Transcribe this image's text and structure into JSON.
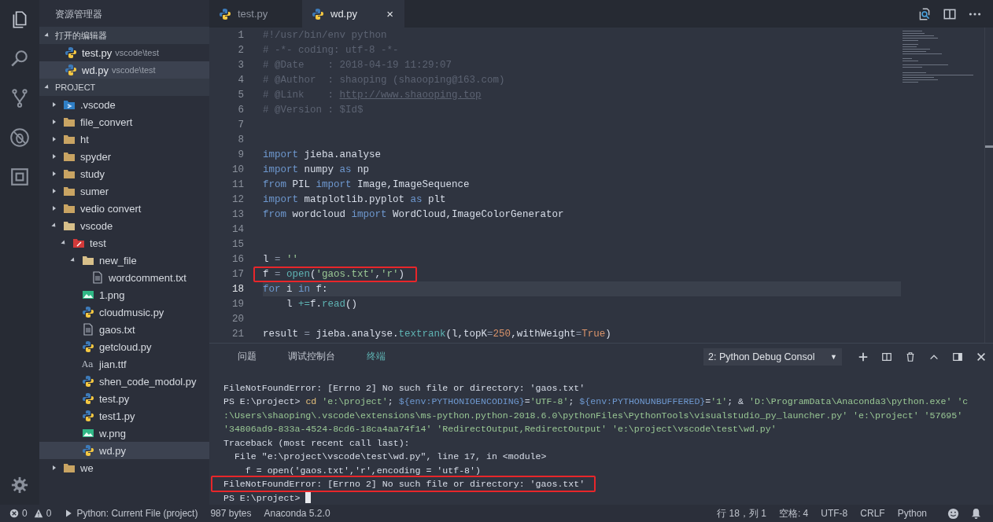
{
  "sidebar": {
    "title": "资源管理器",
    "open_editors": {
      "title": "打开的编辑器",
      "expanded": true,
      "items": [
        {
          "label": "test.py",
          "path": "vscode\\test",
          "kind": "python",
          "selected": false
        },
        {
          "label": "wd.py",
          "path": "vscode\\test",
          "kind": "python",
          "selected": true
        }
      ]
    },
    "project": {
      "title": "PROJECT",
      "expanded": true,
      "items": [
        {
          "label": ".vscode",
          "kind": "vscode-folder",
          "expanded": false,
          "selected": false
        },
        {
          "label": "file_convert",
          "kind": "folder",
          "expanded": false,
          "selected": false
        },
        {
          "label": "ht",
          "kind": "folder",
          "expanded": false,
          "selected": false
        },
        {
          "label": "spyder",
          "kind": "folder",
          "expanded": false,
          "selected": false
        },
        {
          "label": "study",
          "kind": "folder",
          "expanded": false,
          "selected": false
        },
        {
          "label": "sumer",
          "kind": "folder",
          "expanded": false,
          "selected": false
        },
        {
          "label": "vedio convert",
          "kind": "folder",
          "expanded": false,
          "selected": false
        },
        {
          "label": "vscode",
          "kind": "folder",
          "expanded": true,
          "selected": false,
          "children": [
            {
              "label": "test",
              "kind": "test-folder",
              "expanded": true,
              "selected": false,
              "children": [
                {
                  "label": "new_file",
                  "kind": "folder",
                  "expanded": true,
                  "selected": false,
                  "children": [
                    {
                      "label": "wordcomment.txt",
                      "kind": "text",
                      "selected": false
                    }
                  ]
                },
                {
                  "label": "1.png",
                  "kind": "image",
                  "selected": false
                },
                {
                  "label": "cloudmusic.py",
                  "kind": "python",
                  "selected": false
                },
                {
                  "label": "gaos.txt",
                  "kind": "text",
                  "selected": false
                },
                {
                  "label": "getcloud.py",
                  "kind": "python",
                  "selected": false
                },
                {
                  "label": "jian.ttf",
                  "kind": "font",
                  "glyph": "Aa",
                  "selected": false
                },
                {
                  "label": "shen_code_modol.py",
                  "kind": "python",
                  "selected": false
                },
                {
                  "label": "test.py",
                  "kind": "python",
                  "selected": false
                },
                {
                  "label": "test1.py",
                  "kind": "python",
                  "selected": false
                },
                {
                  "label": "w.png",
                  "kind": "image",
                  "selected": false
                },
                {
                  "label": "wd.py",
                  "kind": "python",
                  "selected": true
                }
              ]
            }
          ]
        },
        {
          "label": "we",
          "kind": "folder",
          "expanded": false,
          "selected": false
        }
      ]
    }
  },
  "tabs": [
    {
      "label": "test.py",
      "selected": false
    },
    {
      "label": "wd.py",
      "selected": true,
      "close": "×"
    }
  ],
  "editor": {
    "lines": [
      {
        "number": "1",
        "segments": [
          {
            "kind": "comment",
            "text": "#!/usr/bin/env python"
          }
        ]
      },
      {
        "number": "2",
        "segments": [
          {
            "kind": "comment",
            "text": "# -*- coding: utf-8 -*-"
          }
        ]
      },
      {
        "number": "3",
        "segments": [
          {
            "kind": "comment",
            "text": "# @Date    : 2018-04-19 11:29:07"
          }
        ]
      },
      {
        "number": "4",
        "segments": [
          {
            "kind": "comment",
            "text": "# @Author  : shaoping (shaooping@163.com)"
          }
        ]
      },
      {
        "number": "5",
        "segments": [
          {
            "kind": "comment",
            "text": "# @Link    : "
          },
          {
            "kind": "link",
            "text": "http://www.shaooping.top"
          }
        ]
      },
      {
        "number": "6",
        "segments": [
          {
            "kind": "comment",
            "text": "# @Version : $Id$"
          }
        ]
      },
      {
        "number": "7"
      },
      {
        "number": "8"
      },
      {
        "number": "9",
        "segments": [
          {
            "kind": "keyword",
            "text": "import"
          },
          {
            "kind": "plain",
            "text": " jieba.analyse"
          }
        ]
      },
      {
        "number": "10",
        "segments": [
          {
            "kind": "keyword",
            "text": "import"
          },
          {
            "kind": "plain",
            "text": " numpy "
          },
          {
            "kind": "keyword",
            "text": "as"
          },
          {
            "kind": "plain",
            "text": " np"
          }
        ]
      },
      {
        "number": "11",
        "segments": [
          {
            "kind": "keyword",
            "text": "from"
          },
          {
            "kind": "plain",
            "text": " PIL "
          },
          {
            "kind": "keyword",
            "text": "import"
          },
          {
            "kind": "plain",
            "text": " Image,ImageSequence"
          }
        ]
      },
      {
        "number": "12",
        "segments": [
          {
            "kind": "keyword",
            "text": "import"
          },
          {
            "kind": "plain",
            "text": " matplotlib.pyplot "
          },
          {
            "kind": "keyword",
            "text": "as"
          },
          {
            "kind": "plain",
            "text": " plt"
          }
        ]
      },
      {
        "number": "13",
        "segments": [
          {
            "kind": "keyword",
            "text": "from"
          },
          {
            "kind": "plain",
            "text": " wordcloud "
          },
          {
            "kind": "keyword",
            "text": "import"
          },
          {
            "kind": "plain",
            "text": " WordCloud,ImageColorGenerator"
          }
        ]
      },
      {
        "number": "14"
      },
      {
        "number": "15"
      },
      {
        "number": "16",
        "segments": [
          {
            "kind": "plain",
            "text": "l"
          },
          {
            "kind": "operator",
            "text": " = "
          },
          {
            "kind": "string",
            "text": "''"
          }
        ]
      },
      {
        "number": "17",
        "annotated": true,
        "segments": [
          {
            "kind": "plain",
            "text": "f"
          },
          {
            "kind": "operator",
            "text": " = "
          },
          {
            "kind": "function",
            "text": "open"
          },
          {
            "kind": "plain",
            "text": "("
          },
          {
            "kind": "string",
            "text": "'gaos.txt'"
          },
          {
            "kind": "plain",
            "text": ","
          },
          {
            "kind": "string",
            "text": "'r'"
          },
          {
            "kind": "plain",
            "text": ")"
          }
        ]
      },
      {
        "number": "18",
        "current": true,
        "segments": [
          {
            "kind": "keyword",
            "text": "for"
          },
          {
            "kind": "plain",
            "text": " i "
          },
          {
            "kind": "keyword",
            "text": "in"
          },
          {
            "kind": "plain",
            "text": " f:"
          }
        ]
      },
      {
        "number": "19",
        "segments": [
          {
            "kind": "plain",
            "text": "    l "
          },
          {
            "kind": "function",
            "text": "+="
          },
          {
            "kind": "plain",
            "text": "f."
          },
          {
            "kind": "function",
            "text": "read"
          },
          {
            "kind": "plain",
            "text": "()"
          }
        ]
      },
      {
        "number": "20"
      },
      {
        "number": "21",
        "segments": [
          {
            "kind": "plain",
            "text": "result"
          },
          {
            "kind": "operator",
            "text": " = "
          },
          {
            "kind": "plain",
            "text": "jieba.analyse."
          },
          {
            "kind": "function",
            "text": "textrank"
          },
          {
            "kind": "plain",
            "text": "(l,topK"
          },
          {
            "kind": "operator",
            "text": "="
          },
          {
            "kind": "number",
            "text": "250"
          },
          {
            "kind": "plain",
            "text": ",withWeight"
          },
          {
            "kind": "operator",
            "text": "="
          },
          {
            "kind": "number",
            "text": "True"
          },
          {
            "kind": "plain",
            "text": ")"
          }
        ]
      }
    ]
  },
  "panel": {
    "tabs": [
      {
        "label": "问题",
        "selected": false
      },
      {
        "label": "调试控制台",
        "selected": false
      },
      {
        "label": "终端",
        "selected": true
      }
    ],
    "terminal_select": {
      "value": "2: Python Debug Consol",
      "arrow": "▼"
    },
    "lines": [
      {
        "segments": [
          {
            "kind": "plain",
            "text": "FileNotFoundError: [Errno 2] No such file or directory: 'gaos.txt'"
          }
        ]
      },
      {
        "segments": [
          {
            "kind": "plain",
            "text": "PS E:\\project> "
          },
          {
            "kind": "command",
            "text": "cd"
          },
          {
            "kind": "string",
            "text": " 'e:\\project'"
          },
          {
            "kind": "plain",
            "text": "; "
          },
          {
            "kind": "variable",
            "text": "${env:PYTHONIOENCODING}"
          },
          {
            "kind": "plain",
            "text": "="
          },
          {
            "kind": "string",
            "text": "'UTF-8'"
          },
          {
            "kind": "plain",
            "text": "; "
          },
          {
            "kind": "variable",
            "text": "${env:PYTHONUNBUFFERED}"
          },
          {
            "kind": "plain",
            "text": "="
          },
          {
            "kind": "string",
            "text": "'1'"
          },
          {
            "kind": "plain",
            "text": "; & "
          },
          {
            "kind": "string",
            "text": "'D:\\ProgramData\\Anaconda3\\python.exe' 'c"
          }
        ]
      },
      {
        "segments": [
          {
            "kind": "string",
            "text": ":\\Users\\shaoping\\.vscode\\extensions\\ms-python.python-2018.6.0\\pythonFiles\\PythonTools\\visualstudio_py_launcher.py' 'e:\\project' '57695'"
          }
        ]
      },
      {
        "segments": [
          {
            "kind": "string",
            "text": "'34806ad9-833a-4524-8cd6-18ca4aa74f14' 'RedirectOutput,RedirectOutput' 'e:\\project\\vscode\\test\\wd.py'"
          }
        ]
      },
      {
        "segments": [
          {
            "kind": "plain",
            "text": "Traceback (most recent call last):"
          }
        ]
      },
      {
        "segments": [
          {
            "kind": "plain",
            "text": "  File \"e:\\project\\vscode\\test\\wd.py\", line 17, in <module>"
          }
        ]
      },
      {
        "segments": [
          {
            "kind": "plain",
            "text": "    f = open('gaos.txt','r',encoding = 'utf-8')"
          }
        ]
      },
      {
        "annotated": true,
        "segments": [
          {
            "kind": "plain",
            "text": "FileNotFoundError: [Errno 2] No such file or directory: 'gaos.txt'"
          }
        ]
      },
      {
        "cursor": true,
        "segments": [
          {
            "kind": "plain",
            "text": "PS E:\\project> "
          }
        ]
      }
    ]
  },
  "status_bar": {
    "errors": "0",
    "warnings": "0",
    "debug_config": "Python: Current File (project)",
    "file_size": "987 bytes",
    "interpreter": "Anaconda 5.2.0",
    "position": "行 18，列 1",
    "indent": "空格: 4",
    "encoding": "UTF-8",
    "line_ending": "CRLF",
    "language": "Python"
  }
}
